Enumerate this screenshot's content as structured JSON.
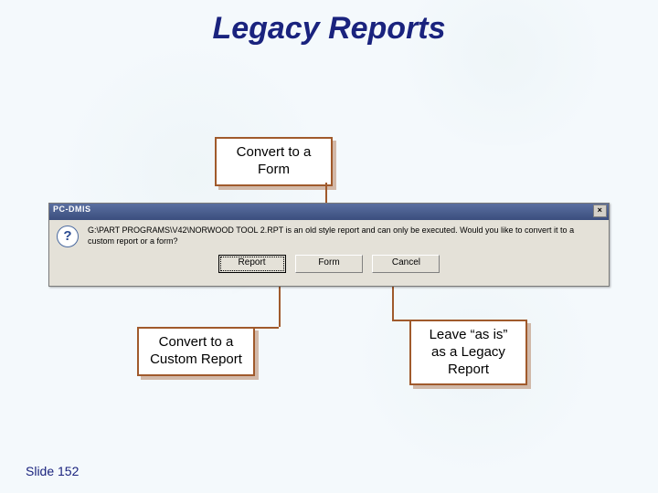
{
  "title": "Legacy Reports",
  "callouts": {
    "top": "Convert to a Form",
    "left": "Convert to a Custom Report",
    "right": "Leave “as is” as a Legacy Report"
  },
  "dialog": {
    "titlebar": "PC-DMIS",
    "close_glyph": "×",
    "icon_glyph": "?",
    "message": "G:\\PART PROGRAMS\\V42\\NORWOOD TOOL 2.RPT is an old style report and can only be executed. Would you like to convert it to a custom report or a form?",
    "buttons": {
      "report": "Report",
      "form": "Form",
      "cancel": "Cancel"
    }
  },
  "footer": "Slide 152"
}
